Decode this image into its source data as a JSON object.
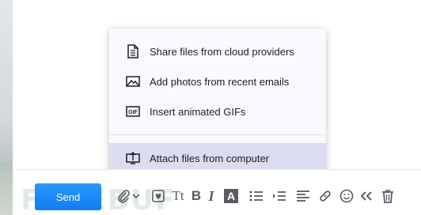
{
  "menu": {
    "items": [
      {
        "label": "Share files from cloud providers",
        "icon": "document-icon"
      },
      {
        "label": "Add photos from recent emails",
        "icon": "image-icon"
      },
      {
        "label": "Insert animated GIFs",
        "icon": "gif-icon"
      },
      {
        "label": "Attach files from computer",
        "icon": "computer-upload-icon",
        "highlighted": true
      }
    ]
  },
  "footer": {
    "send_label": "Send",
    "toolbar_icons": [
      "paperclip-icon",
      "chevron-down-icon",
      "sticker-icon",
      "font-size-icon",
      "bold-icon",
      "italic-icon",
      "text-color-icon",
      "bulleted-list-icon",
      "indent-icon",
      "align-icon",
      "link-icon",
      "emoji-icon",
      "double-chevron-left-icon",
      "trash-icon"
    ],
    "gif_badge": "GIF",
    "font_size_glyph": "Tt",
    "bold_glyph": "B",
    "italic_glyph": "I",
    "text_color_glyph": "A"
  },
  "colors": {
    "send_button": "#1a8cff",
    "menu_background": "#faf9ff",
    "menu_highlight": "#dcdcf0",
    "icon_gray": "#5b5b66"
  }
}
